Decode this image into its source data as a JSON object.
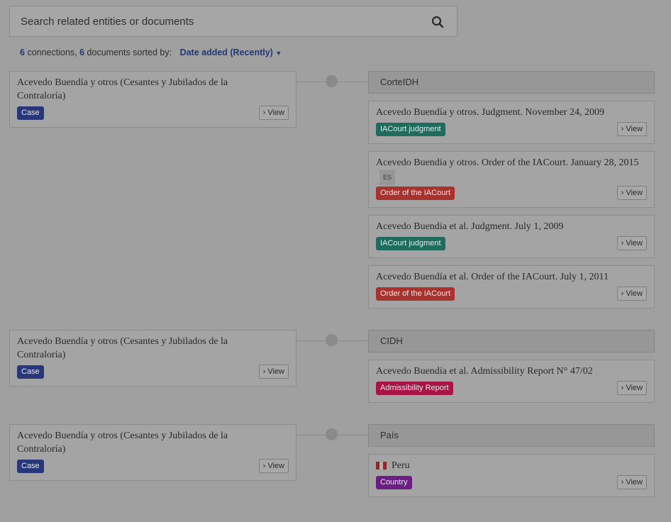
{
  "search": {
    "placeholder": "Search related entities or documents"
  },
  "summary": {
    "connections_count": "6",
    "connections_label": "connections,",
    "documents_count": "6",
    "documents_label": "documents sorted by:",
    "sort_value": "Date added (Recently)"
  },
  "view_label": "View",
  "groups": [
    {
      "entity": {
        "title": "Acevedo Buendía y otros (Cesantes y Jubilados de la Contraloría)",
        "badge": "Case"
      },
      "header": "CorteIDH",
      "docs": [
        {
          "title": "Acevedo Buendía y otros. Judgment. November 24, 2009",
          "badge": "IACourt judgment"
        },
        {
          "title": "Acevedo Buendía y otros. Order of the IACourt. January 28, 2015",
          "lang": "ES",
          "badge": "Order of the IACourt"
        },
        {
          "title": "Acevedo Buendía et al. Judgment. July 1, 2009",
          "badge": "IACourt judgment"
        },
        {
          "title": "Acevedo Buendía et al. Order of the IACourt. July 1, 2011",
          "badge": "Order of the IACourt"
        }
      ]
    },
    {
      "entity": {
        "title": "Acevedo Buendía y otros (Cesantes y Jubilados de la Contraloría)",
        "badge": "Case"
      },
      "header": "CIDH",
      "docs": [
        {
          "title": "Acevedo Buendía et al. Admissibility Report N° 47/02",
          "badge": "Admissibility Report"
        }
      ]
    },
    {
      "entity": {
        "title": "Acevedo Buendía y otros (Cesantes y Jubilados de la Contraloría)",
        "badge": "Case"
      },
      "header": "País",
      "docs": [
        {
          "title": "Peru",
          "badge": "Country",
          "flag": "peru-flag"
        }
      ]
    }
  ],
  "colors": {
    "case": "#28367a",
    "iacourt_judgment": "#1f6b5e",
    "order_iacourt": "#a8322e",
    "admissibility_report": "#a81445",
    "country": "#6a1d82",
    "link": "#1e3a78"
  }
}
